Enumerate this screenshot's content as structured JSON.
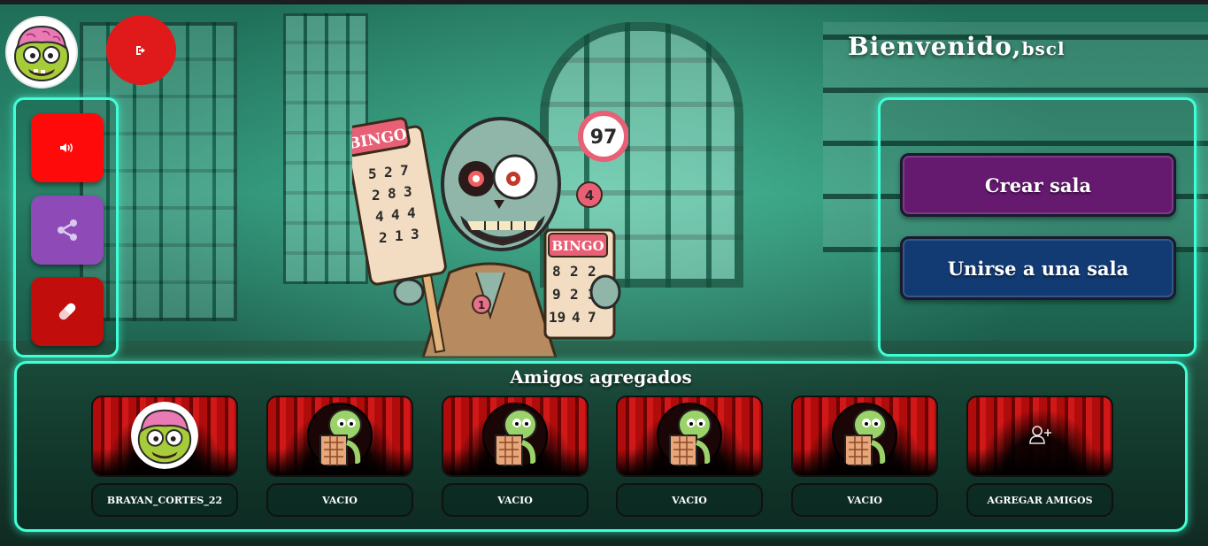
{
  "header": {
    "welcome_prefix": "Bienvenido,",
    "username": "bscl",
    "logout_icon": "logout-icon"
  },
  "side_controls": [
    {
      "name": "sound",
      "icon": "volume-icon",
      "color": "#ff0a0a"
    },
    {
      "name": "share",
      "icon": "share-icon",
      "color": "#8e4bb8"
    },
    {
      "name": "pill",
      "icon": "pill-icon",
      "color": "#c20d0d"
    }
  ],
  "rooms": {
    "create_label": "Crear sala",
    "join_label": "Unirse a una sala"
  },
  "friends": {
    "title": "Amigos agregados",
    "items": [
      {
        "label": "brayan_cortes_22",
        "avatar": "brain-zombie"
      },
      {
        "label": "Vacio",
        "avatar": "bingo-zombie"
      },
      {
        "label": "Vacio",
        "avatar": "bingo-zombie"
      },
      {
        "label": "Vacio",
        "avatar": "bingo-zombie"
      },
      {
        "label": "Vacio",
        "avatar": "bingo-zombie"
      },
      {
        "label": "Agregar amigos",
        "avatar": "add-user-icon"
      }
    ]
  },
  "illustration": {
    "card1_title": "BINGO",
    "card1_numbers": [
      "5",
      "2",
      "7",
      "2",
      "8",
      "3",
      "4",
      "4",
      "4",
      "2",
      "1",
      "3"
    ],
    "card2_title": "BINGO",
    "card2_numbers": [
      "8",
      "2",
      "2",
      "9",
      "2",
      "3",
      "19",
      "4",
      "7"
    ],
    "ball_97": "97",
    "ball_4": "4",
    "badge": "1"
  },
  "colors": {
    "neon_border": "#3fffd6",
    "create_bg": "#651a6f",
    "join_bg": "#123a73",
    "logout_bg": "#e01a1a"
  }
}
